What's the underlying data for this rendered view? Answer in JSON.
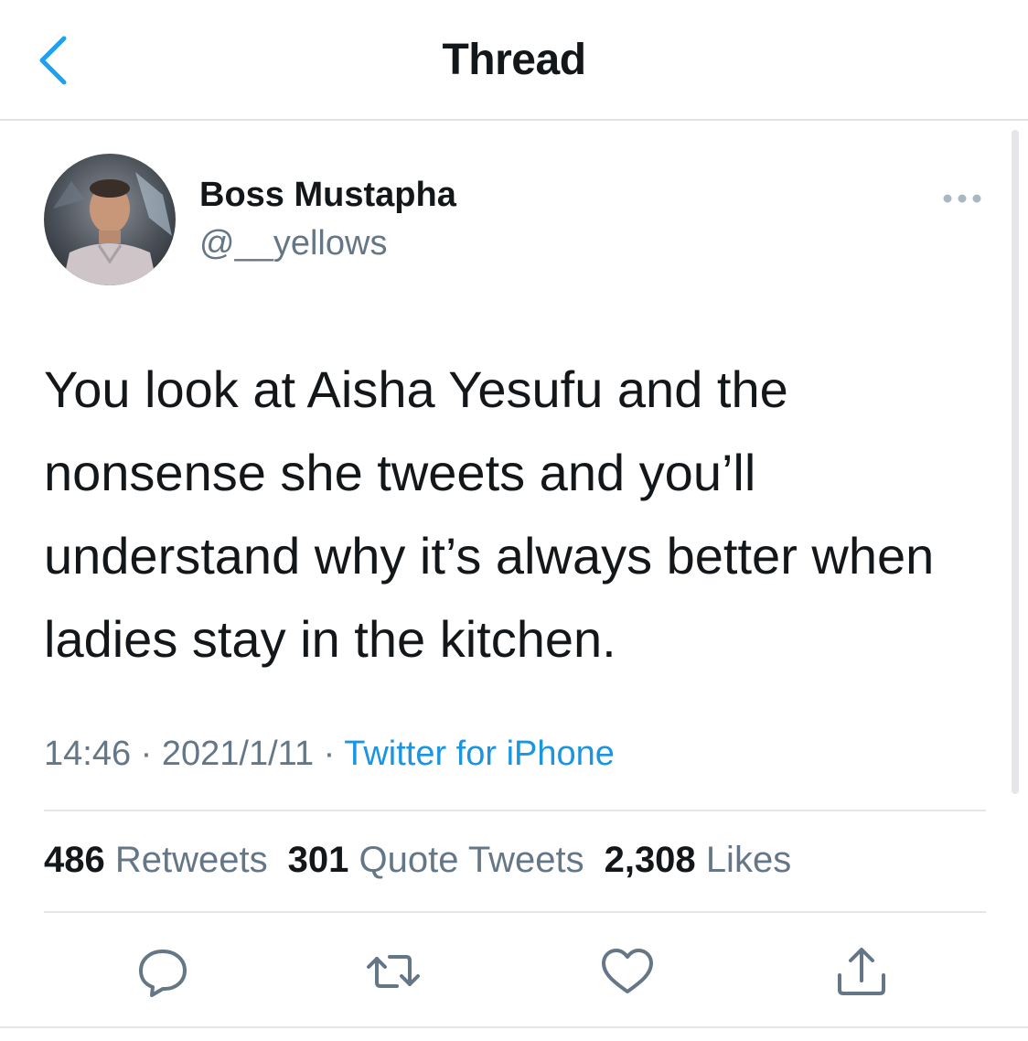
{
  "header": {
    "title": "Thread",
    "back_icon": "chevron-left-icon"
  },
  "tweet": {
    "author": {
      "name": "Boss Mustapha",
      "handle": "@__yellows",
      "avatar_icon": "profile-photo"
    },
    "more_icon": "more-horizontal-icon",
    "text": "You look at Aisha Yesufu and the nonsense she tweets and you’ll understand why it’s always better when ladies stay in the kitchen.",
    "time": "14:46",
    "separator": " · ",
    "date": "2021/1/11",
    "source": "Twitter for iPhone"
  },
  "stats": {
    "retweets_count": "486",
    "retweets_label": "Retweets",
    "quote_tweets_count": "301",
    "quote_tweets_label": "Quote Tweets",
    "likes_count": "2,308",
    "likes_label": "Likes"
  },
  "actions": [
    {
      "icon": "reply-icon"
    },
    {
      "icon": "retweet-icon"
    },
    {
      "icon": "like-icon"
    },
    {
      "icon": "share-icon"
    }
  ],
  "colors": {
    "accent": "#1b95e0",
    "text": "#14171a",
    "secondary_text": "#657786",
    "divider": "#e6e6e8"
  }
}
